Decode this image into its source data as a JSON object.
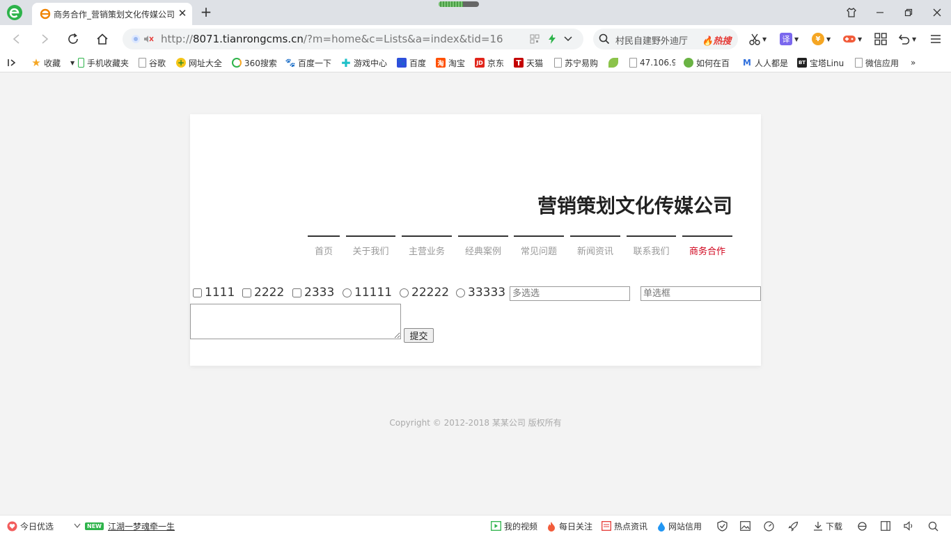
{
  "browser": {
    "tab_title": "商务合作_营销策划文化传媒公司",
    "loading_progress": 0.6,
    "url_prefix": "http://",
    "url_host": "8071.tianrongcms.cn",
    "url_path": "/?m=home&c=Lists&a=index&tid=16",
    "search_query": "村民自建野外迪厅",
    "search_hot_label": "热搜",
    "translate_label": "译",
    "coin_label": "¥"
  },
  "bookmarks": [
    {
      "label": "收藏",
      "icon": "star-icon"
    },
    {
      "label": "手机收藏夹",
      "icon": "phone-icon"
    },
    {
      "label": "谷歌",
      "icon": "page-icon"
    },
    {
      "label": "网址大全",
      "icon": "plus-circle-icon"
    },
    {
      "label": "360搜索",
      "icon": "360-search-icon"
    },
    {
      "label": "百度一下",
      "icon": "paw-icon"
    },
    {
      "label": "游戏中心",
      "icon": "game-cross-icon"
    },
    {
      "label": "百度",
      "icon": "paw-icon"
    },
    {
      "label": "淘宝",
      "icon": "taobao-icon",
      "badge": "淘"
    },
    {
      "label": "京东",
      "icon": "jd-icon",
      "badge": "JD"
    },
    {
      "label": "天猫",
      "icon": "tmall-icon",
      "badge": "T"
    },
    {
      "label": "苏宁易购",
      "icon": "page-icon"
    },
    {
      "label": "",
      "icon": "leaf-icon"
    },
    {
      "label": "47.106.9",
      "icon": "page-icon"
    },
    {
      "label": "如何在百",
      "icon": "green-ball-icon"
    },
    {
      "label": "人人都是",
      "icon": "m-logo-icon"
    },
    {
      "label": "宝塔Linu",
      "icon": "bt-icon",
      "badge": "BT"
    },
    {
      "label": "微信应用",
      "icon": "page-icon"
    },
    {
      "label": "»",
      "icon": "more-icon"
    }
  ],
  "site": {
    "title": "营销策划文化传媒公司",
    "nav": [
      {
        "label": "首页",
        "active": false
      },
      {
        "label": "关于我们",
        "active": false
      },
      {
        "label": "主营业务",
        "active": false
      },
      {
        "label": "经典案例",
        "active": false
      },
      {
        "label": "常见问题",
        "active": false
      },
      {
        "label": "新闻资讯",
        "active": false
      },
      {
        "label": "联系我们",
        "active": false
      },
      {
        "label": "商务合作",
        "active": true
      }
    ]
  },
  "form": {
    "checkboxes": [
      "1111",
      "2222",
      "2333"
    ],
    "radios": [
      "11111",
      "22222",
      "33333"
    ],
    "multi_placeholder": "多选选",
    "single_placeholder": "单选框",
    "submit_label": "提交"
  },
  "footer": {
    "copyright": "Copyright © 2012-2018 某某公司 版权所有"
  },
  "statusbar": {
    "today": "今日优选",
    "new_badge": "NEW",
    "news": "江湖一梦魂牵一生",
    "video": "我的视频",
    "daily": "每日关注",
    "hot": "热点资讯",
    "credit": "网站信用",
    "download": "下载"
  },
  "colors": {
    "active_nav": "#d0021b",
    "hot": "#e53935",
    "brand_green": "#2db34a"
  }
}
